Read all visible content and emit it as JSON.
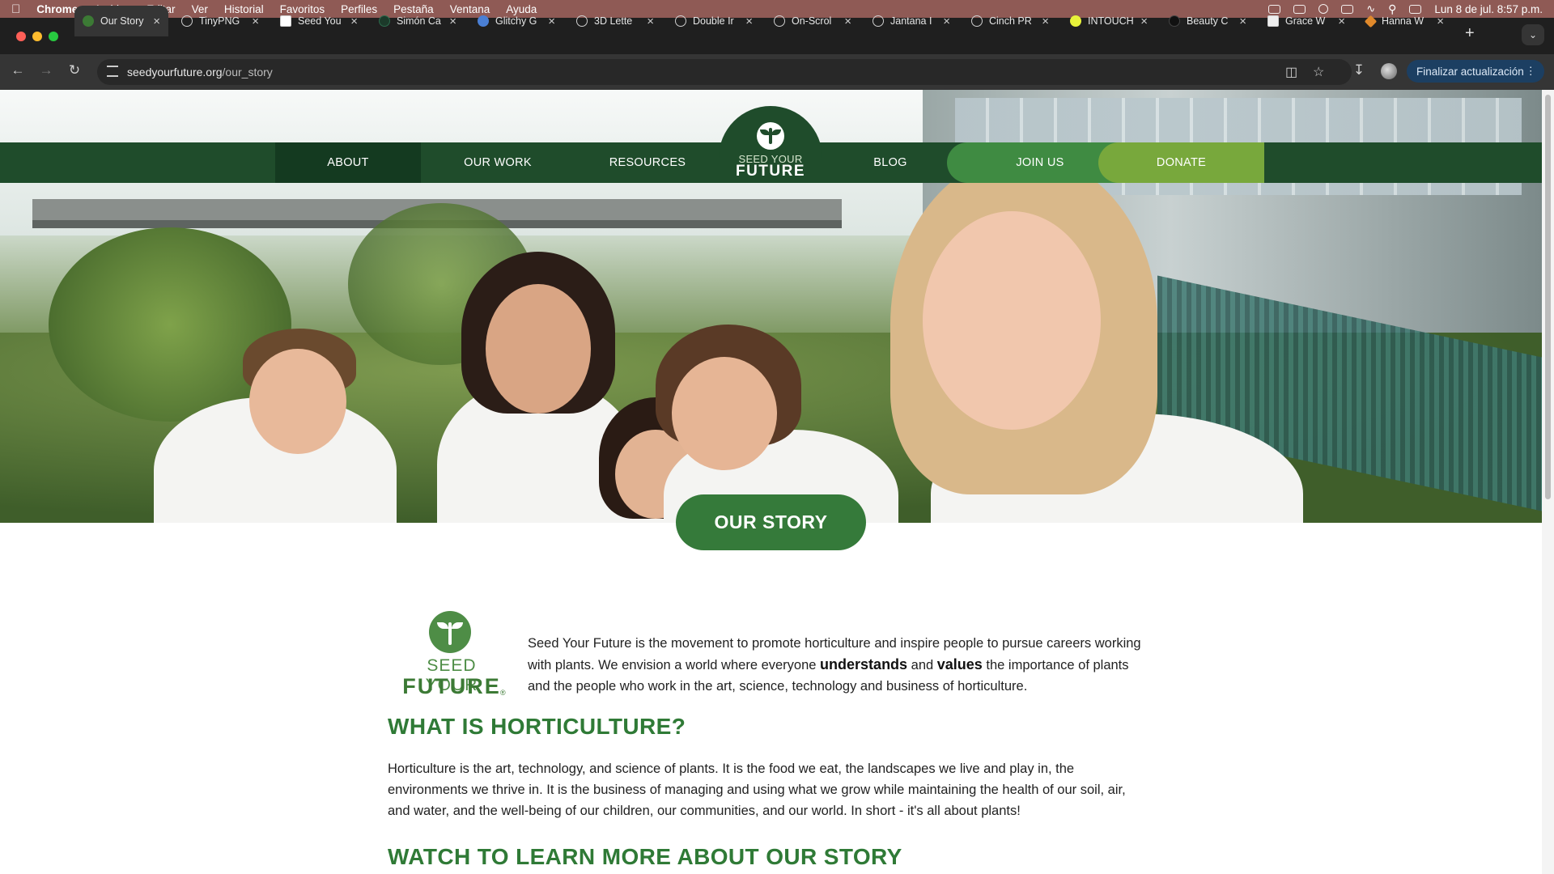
{
  "menubar": {
    "app": "Chrome",
    "items": [
      "Archivo",
      "Editar",
      "Ver",
      "Historial",
      "Favoritos",
      "Perfiles",
      "Pestaña",
      "Ventana",
      "Ayuda"
    ],
    "clock": "Lun 8 de jul.  8:57 p.m."
  },
  "tabs": [
    {
      "title": "Our Story",
      "active": true
    },
    {
      "title": "TinyPNG"
    },
    {
      "title": "Seed You"
    },
    {
      "title": "Simón Ca"
    },
    {
      "title": "Glitchy G"
    },
    {
      "title": "3D Lette"
    },
    {
      "title": "Double Ir"
    },
    {
      "title": "On-Scrol"
    },
    {
      "title": "Jantana I"
    },
    {
      "title": "Cinch PR"
    },
    {
      "title": "INTOUCH"
    },
    {
      "title": "Beauty C"
    },
    {
      "title": "Grace W"
    },
    {
      "title": "Hanna W"
    }
  ],
  "toolbar": {
    "url_host": "seedyourfuture.org",
    "url_path": "/our_story",
    "update_label": "Finalizar actualización"
  },
  "nav": {
    "about": "ABOUT",
    "our_work": "OUR WORK",
    "resources": "RESOURCES",
    "logo_line1": "SEED YOUR",
    "logo_line2": "FUTURE",
    "blog": "BLOG",
    "join": "JOIN US",
    "donate": "DONATE"
  },
  "hero": {
    "pill": "OUR STORY"
  },
  "content": {
    "logo_line1": "SEED YOUR",
    "logo_line2": "FUTURE",
    "logo_reg": "®",
    "intro_part1": "Seed Your Future is the movement to promote horticulture and inspire people to pursue careers working with plants. We envision a world where everyone ",
    "intro_b1": "understands",
    "intro_part2": " and ",
    "intro_b2": "values",
    "intro_part3": " the importance of plants and the people who work in the art, science, technology and business of horticulture.",
    "heading1": "WHAT IS HORTICULTURE?",
    "paragraph1": "Horticulture is the art, technology, and science of plants. It is the food we eat, the landscapes we live and play in, the environments we thrive in. It is the business of managing and using what we grow while maintaining the health of our soil, air, and water, and the well-being of our children, our communities, and our world. In short - it's all about plants!",
    "heading2": "WATCH TO LEARN MORE ABOUT OUR STORY"
  },
  "colors": {
    "nav_dark": "#1f4c2b",
    "nav_active": "#143a20",
    "join": "#3f8b42",
    "donate": "#78a83c",
    "heading_green": "#2f7a36"
  }
}
